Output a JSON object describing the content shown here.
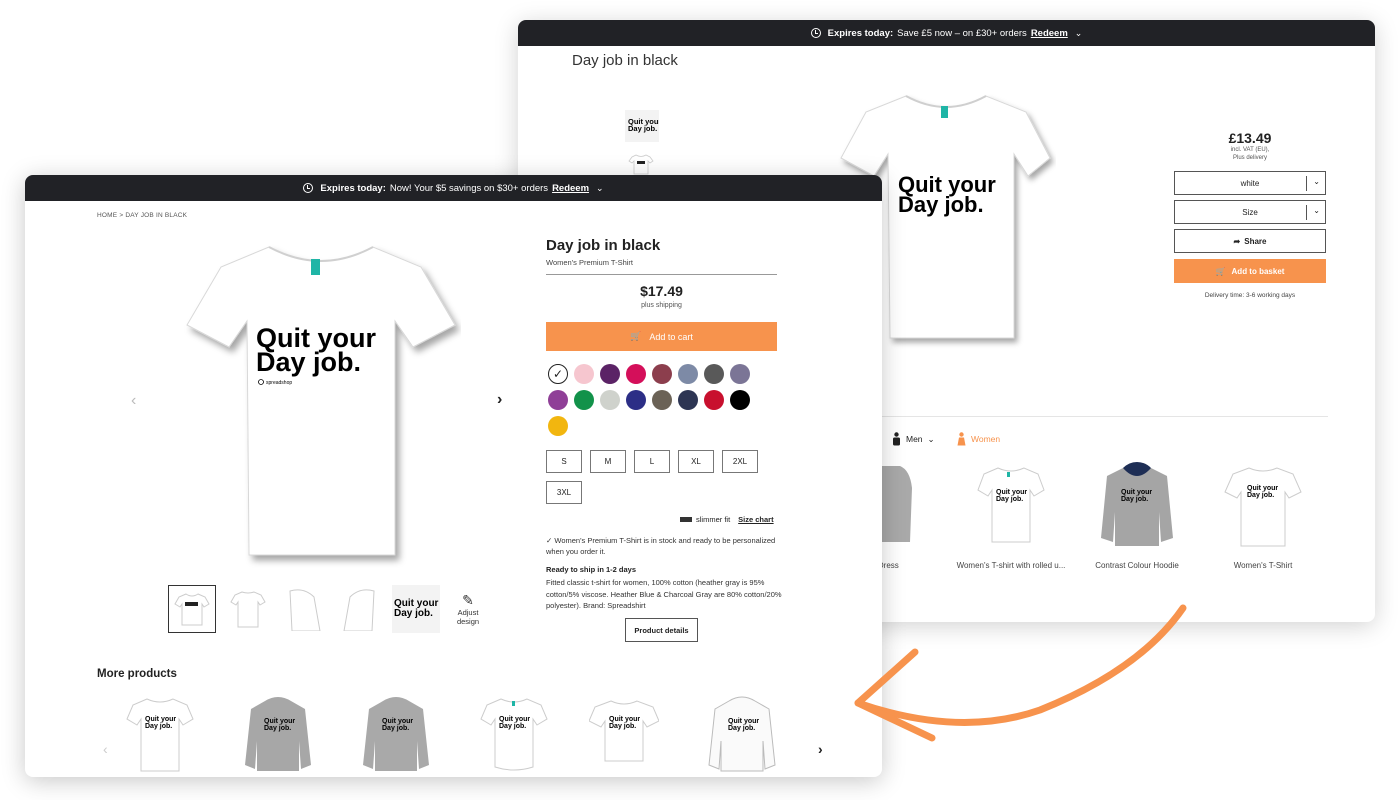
{
  "old_page": {
    "promo": {
      "prefix": "Expires today:",
      "text": "Save £5 now – on £30+ orders",
      "link": "Redeem"
    },
    "title": "Day job in black",
    "price": "£13.49",
    "vat_note": "incl. VAT (EU),",
    "delivery_note": "Plus delivery",
    "color_select": "white",
    "size_select": "Size",
    "share_label": "Share",
    "basket_label": "Add to basket",
    "delivery_time": "Delivery time: 3-6 working days",
    "gender_men": "Men",
    "gender_women": "Women",
    "products": [
      {
        "label": "e Dress"
      },
      {
        "label": "Women's T-shirt with rolled u..."
      },
      {
        "label": "Contrast Colour Hoodie"
      },
      {
        "label": "Women's T-Shirt"
      }
    ]
  },
  "new_page": {
    "promo": {
      "prefix": "Expires today:",
      "text": "Now! Your $5 savings on $30+ orders",
      "link": "Redeem"
    },
    "breadcrumb": {
      "home": "HOME",
      "sep": ">",
      "current": "DAY JOB IN BLACK"
    },
    "design_text": {
      "line1": "Quit your",
      "line2": "Day job.",
      "brand": "spreadshop"
    },
    "title": "Day job in black",
    "subtitle": "Women's Premium T-Shirt",
    "price": "$17.49",
    "shipping": "plus shipping",
    "cart_label": "Add to cart",
    "colors": [
      "#ffffff",
      "#f6c6cf",
      "#5b2366",
      "#d40f5a",
      "#8c3e4d",
      "#7d8aa6",
      "#595959",
      "#7b7596",
      "#8f3f97",
      "#12924a",
      "#cfd2cc",
      "#2c2e86",
      "#6b6256",
      "#2d3553",
      "#c8102e",
      "#000000",
      "#f2b60f"
    ],
    "sizes": [
      "S",
      "M",
      "L",
      "XL",
      "2XL",
      "3XL"
    ],
    "fit_label": "slimmer fit",
    "size_chart": "Size chart",
    "stock_text": "Women's Premium T-Shirt is in stock and ready to be personalized when you order it.",
    "ready_title": "Ready to ship in 1-2 days",
    "description": "Fitted classic t-shirt for women, 100% cotton (heather gray is 95% cotton/5% viscose. Heather Blue & Charcoal Gray are 80% cotton/20% polyester). Brand: Spreadshirt",
    "details_label": "Product details",
    "adjust_line1": "Adjust",
    "adjust_line2": "design",
    "more_title": "More products"
  },
  "colors": {
    "accent": "#f7934d",
    "topbar": "#212226"
  },
  "icons": [
    "clock-icon",
    "chevron-down-icon",
    "cart-icon",
    "share-icon",
    "pencil-icon",
    "checkmark-icon",
    "chevron-left-icon",
    "chevron-right-icon",
    "ruler-icon"
  ]
}
